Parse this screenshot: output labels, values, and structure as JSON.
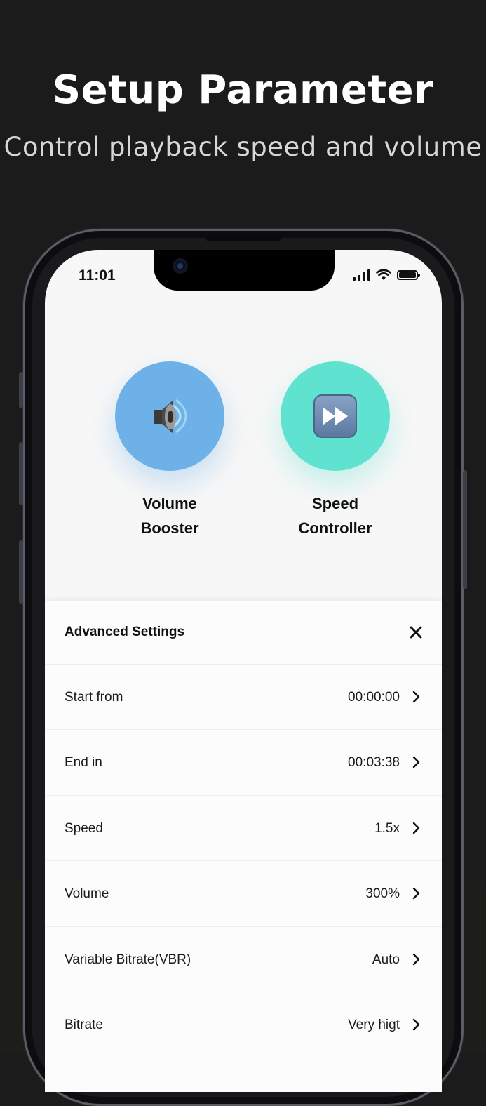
{
  "promo": {
    "headline": "Setup Parameter",
    "subhead": "Control playback speed and volume"
  },
  "status_bar": {
    "time": "11:01"
  },
  "features": [
    {
      "label_line1": "Volume",
      "label_line2": "Booster",
      "icon": "speaker-icon",
      "color": "#6db1e8"
    },
    {
      "label_line1": "Speed",
      "label_line2": "Controller",
      "icon": "fast-forward-icon",
      "color": "#5fe2d0"
    }
  ],
  "settings": {
    "title": "Advanced Settings",
    "rows": [
      {
        "label": "Start from",
        "value": "00:00:00"
      },
      {
        "label": "End in",
        "value": "00:03:38"
      },
      {
        "label": "Speed",
        "value": "1.5x"
      },
      {
        "label": "Volume",
        "value": "300%"
      },
      {
        "label": "Variable Bitrate(VBR)",
        "value": "Auto"
      },
      {
        "label": "Bitrate",
        "value": "Very higt"
      }
    ]
  }
}
